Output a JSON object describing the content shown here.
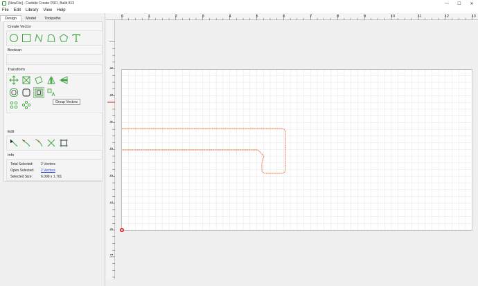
{
  "window": {
    "title": "[NewFile] - Carbide Create PRO, Build 813",
    "controls": [
      "—",
      "☐",
      "✕"
    ]
  },
  "menu": [
    "File",
    "Edit",
    "Library",
    "View",
    "Help"
  ],
  "tabs": [
    "Design",
    "Model",
    "Toolpaths"
  ],
  "sections": {
    "create_vector": "Create Vector",
    "boolean": "Boolean",
    "transform": "Transform",
    "edit": "Edit",
    "info": "Info"
  },
  "tooltip": "Group Vectors",
  "info": {
    "total_selected_label": "Total Selected:",
    "total_selected_value": "2 Vectors",
    "open_selected_label": "Open Selected:",
    "open_selected_value": "2 Vectors",
    "selected_size_label": "Selected Size:",
    "selected_size_value": "6.099 x 1.701"
  },
  "ruler": {
    "x_labels": [
      "0",
      "1",
      "2",
      "3",
      "4",
      "5",
      "6",
      "7",
      "8",
      "9",
      "10",
      "11",
      "12",
      "13"
    ],
    "y_labels": [
      "6",
      "5",
      "4",
      "3",
      "2",
      "1",
      "0",
      "-1"
    ]
  },
  "colors": {
    "accent_green": "#3da53d",
    "vector_orange": "#e8743b",
    "grid": "#dedede",
    "origin_red": "#e02020"
  }
}
